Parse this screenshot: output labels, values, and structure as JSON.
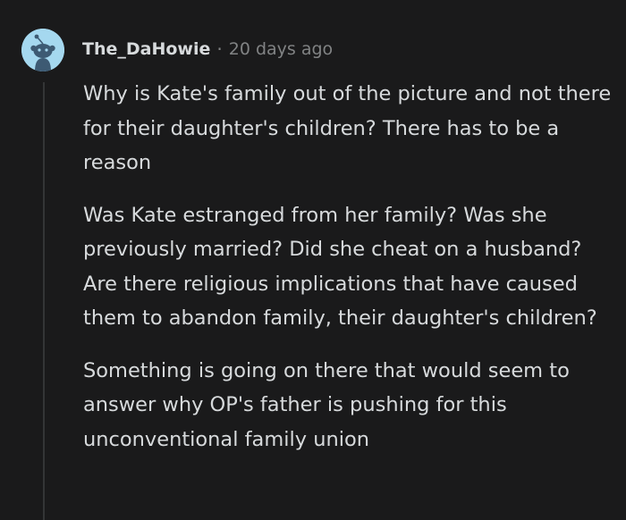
{
  "comment": {
    "author": "The_DaHowie",
    "separator": "·",
    "timestamp": "20 days ago",
    "avatar_icon": "snoo-avatar-icon",
    "paragraphs": [
      "Why is Kate's family out of the picture and not there for their daughter's children? There has to be a reason",
      "Was Kate estranged from her family? Was she previously married? Did she cheat on a husband? Are there religious implications that have caused them to abandon family, their daughter's children?",
      "Something is going on there that would seem to answer why OP's father is pushing for this unconventional family union"
    ]
  },
  "colors": {
    "background": "#1a1a1b",
    "text": "#d7dadc",
    "muted": "#818384",
    "avatar_bg": "#a5d8ef",
    "thread_line": "#343536"
  }
}
